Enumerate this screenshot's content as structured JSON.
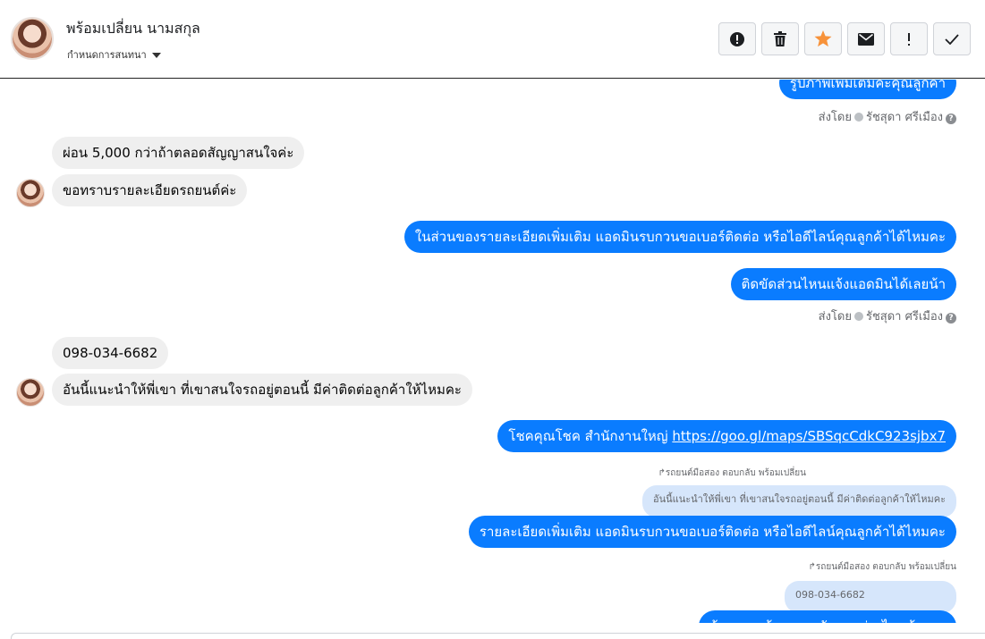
{
  "header": {
    "contact_name": "พร้อมเปลี่ยน นามสกุล",
    "subtitle": "กำหนดการสนทนา",
    "actions": [
      {
        "name": "alert-circle-icon",
        "glyph": "!"
      },
      {
        "name": "trash-icon",
        "glyph": "🗑"
      },
      {
        "name": "star-icon",
        "glyph": "★"
      },
      {
        "name": "mail-icon",
        "glyph": "✉"
      },
      {
        "name": "exclamation-icon",
        "glyph": "!"
      },
      {
        "name": "check-icon",
        "glyph": "✓"
      }
    ]
  },
  "colors": {
    "outgoing": "#0a7cff",
    "incoming": "#efefef",
    "quote": "#d6e6fb",
    "star": "#f7923a"
  },
  "messages": {
    "m0": "รูปภาพเพิ่มเติมค่ะคุณลูกค้า",
    "sent_by_1": {
      "prefix": "ส่งโดย",
      "agent": "รัชสุดา ศรีเมือง"
    },
    "in1": "ผ่อน 5,000 กว่าถ้าตลอดสัญญาสนใจค่ะ",
    "in2": "ขอทราบรายละเอียดรถยนต์ค่ะ",
    "out1": "ในส่วนของรายละเอียดเพิ่มเติม แอดมินรบกวนขอเบอร์ติดต่อ หรือไอดีไลน์คุณลูกค้าได้ไหมคะ",
    "out2": "ติดขัดส่วนไหนแจ้งแอดมินได้เลยน้า",
    "sent_by_2": {
      "prefix": "ส่งโดย",
      "agent": "รัชสุดา ศรีเมือง"
    },
    "in3": "098-034-6682",
    "in4": "อันนี้แนะนำให้พี่เขา ที่เขาสนใจรถอยู่ตอนนี้ มีค่าติดต่อลูกค้าให้ไหมคะ",
    "out3_text": "โชคคุณโชค สำนักงานใหญ่",
    "out3_link": "https://goo.gl/maps/SBSqcCdkC923sjbx7",
    "reply1_label": "รถยนต์มือสอง ตอบกลับ พร้อมเปลี่ยน",
    "reply1_quote": "อันนี้แนะนำให้พี่เขา ที่เขาสนใจรถอยู่ตอนนี้ มีค่าติดต่อลูกค้าให้ไหมคะ",
    "out4": "รายละเอียดเพิ่มเติม แอดมินรบกวนขอเบอร์ติดต่อ หรือไอดีไลน์คุณลูกค้าได้ไหมคะ",
    "reply2_label": "รถยนต์มือสอง ตอบกลับ พร้อมเปลี่ยน",
    "reply2_quote": "098-034-6682",
    "out5": "ถ้าคุณลูกค้าสะดวกรับสายช่วงไหนบ้างคะ"
  }
}
